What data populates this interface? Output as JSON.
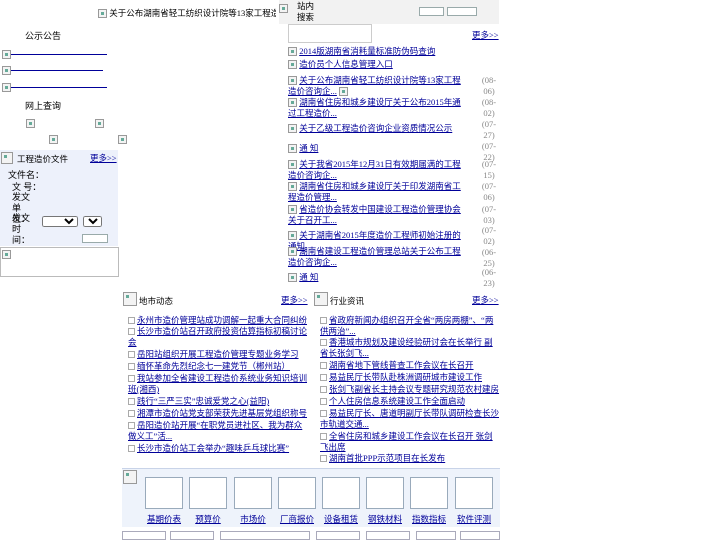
{
  "top_marquee": "关于公布湖南省轻工纺织设计院等13家工程造价咨询企",
  "site_search_label": "站内搜索",
  "left": {
    "notice_title": "公示公告",
    "online_query_title": "网上查询",
    "cost_files": {
      "title": "工程造价文件",
      "more": "更多>>",
      "file_name_label": "文件名：",
      "doc_no_label": "文 号：",
      "issuer_label": "发文单位：",
      "issue_time_label": "发文时间："
    }
  },
  "right_top": {
    "more": "更多>>",
    "links": [
      "2014版湖南省消耗量标准防伪码查询",
      "造价员个人信息管理入口"
    ],
    "news": [
      {
        "title": "关于公布湖南省轻工纺织设计院等13家工程造价咨询企...",
        "date": "(08-06)"
      },
      {
        "title": "湖南省住房和城乡建设厅关于公布2015年通过工程造价...",
        "date": "(08-02)"
      },
      {
        "title": "关于乙级工程造价咨询企业资质情况公示",
        "date": "(07-27)"
      },
      {
        "title": "通 知",
        "date": "(07-22)"
      },
      {
        "title": "关于我省2015年12月31日有效期届满的工程造价咨询企...",
        "date": "(07-15)"
      },
      {
        "title": "湖南省住房和城乡建设厅关于印发湖南省工程造价管理...",
        "date": "(07-06)"
      },
      {
        "title": "省造价协会转发中国建设工程造价管理协会关于召开工...",
        "date": "(07-03)"
      },
      {
        "title": "关于湖南省2015年度造价工程师初始注册的通知",
        "date": "(07-02)"
      },
      {
        "title": "湖南省建设工程造价管理总站关于公布工程造价咨询企...",
        "date": "(06-25)"
      },
      {
        "title": "通 知",
        "date": "(06-23)"
      }
    ]
  },
  "city_news": {
    "title": "地市动态",
    "more": "更多>>",
    "items": [
      "永州市造价管理站成功调解一起重大合同纠纷",
      "长沙市造价站召开政府投资估算指标初稿讨论会",
      "岳阳站组织开展工程造价管理专题业务学习",
      "缅怀革命先烈纪念七一建党节（郴州站）",
      "我站参加全省建设工程造价系统业务知识培训班(湘西)",
      "践行“三严三实”忠诚爱党之心(益阳)",
      "湘潭市造价站党支部荣获先进基层党组织称号",
      "岳阳造价站开展“在职党员进社区、我为群众做义工”活...",
      "长沙市造价站工会举办“趣味乒乓球比赛”"
    ]
  },
  "industry_news": {
    "title": "行业资讯",
    "more": "更多>>",
    "items": [
      "省政府新闻办组织召开全省“两房两棚”、“两供两治”...",
      "香港城市规划及建设经验研讨会在长举行 副省长张剑飞...",
      "湖南省地下管线普查工作会议在长召开",
      "易益民厅长带队赴株洲调研城市建设工作",
      "张剑飞副省长主持会议专题研究规范农村建房",
      "个人住房信息系统建设工作全面启动",
      "易益民厅长、唐道明副厅长带队调研检查长沙市轨道交通...",
      "全省住房和城乡建设工作会议在长召开 张剑飞出席",
      "湖南首批PPP示范项目在长发布"
    ]
  },
  "quick_links": [
    {
      "label": "基期价表",
      "icon": "price-table-icon"
    },
    {
      "label": "预算价",
      "icon": "budget-price-icon"
    },
    {
      "label": "市场价",
      "icon": "market-price-icon"
    },
    {
      "label": "厂商报价",
      "icon": "vendor-quote-icon"
    },
    {
      "label": "设备租赁",
      "icon": "equipment-lease-icon"
    },
    {
      "label": "钢铁材料",
      "icon": "steel-material-icon"
    },
    {
      "label": "指数指标",
      "icon": "index-indicator-icon"
    },
    {
      "label": "软件评测",
      "icon": "software-review-icon"
    }
  ]
}
